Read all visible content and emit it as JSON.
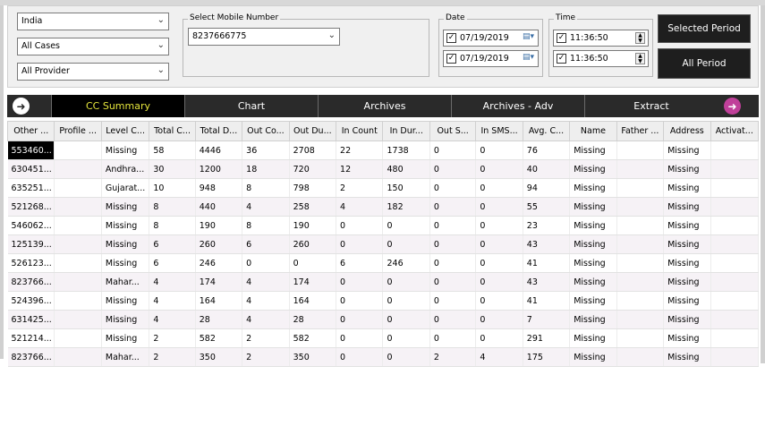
{
  "filters": {
    "country": "India",
    "cases": "All Cases",
    "provider": "All Provider",
    "mobile_legend": "Select Mobile Number",
    "mobile_value": "8237666775",
    "date_legend": "Date",
    "date_from": "07/19/2019",
    "date_to": "07/19/2019",
    "time_legend": "Time",
    "time_from": "11:36:50",
    "time_to": "11:36:50",
    "selected_period_label": "Selected Period",
    "all_period_label": "All Period"
  },
  "tabs": [
    "CC Summary",
    "Chart",
    "Archives",
    "Archives - Adv",
    "Extract"
  ],
  "active_tab": "CC Summary",
  "columns": [
    "Other ...",
    "Profile ...",
    "Level C...",
    "Total C...",
    "Total D...",
    "Out Co...",
    "Out Du...",
    "In Count",
    "In Dur...",
    "Out S...",
    "In SMS...",
    "Avg. C...",
    "Name",
    "Father ...",
    "Address",
    "Activat..."
  ],
  "rows": [
    [
      "553460...",
      "",
      "Missing",
      "58",
      "4446",
      "36",
      "2708",
      "22",
      "1738",
      "0",
      "0",
      "76",
      "Missing",
      "",
      "Missing",
      ""
    ],
    [
      "630451...",
      "",
      "Andhra...",
      "30",
      "1200",
      "18",
      "720",
      "12",
      "480",
      "0",
      "0",
      "40",
      "Missing",
      "",
      "Missing",
      ""
    ],
    [
      "635251...",
      "",
      "Gujarat...",
      "10",
      "948",
      "8",
      "798",
      "2",
      "150",
      "0",
      "0",
      "94",
      "Missing",
      "",
      "Missing",
      ""
    ],
    [
      "521268...",
      "",
      "Missing",
      "8",
      "440",
      "4",
      "258",
      "4",
      "182",
      "0",
      "0",
      "55",
      "Missing",
      "",
      "Missing",
      ""
    ],
    [
      "546062...",
      "",
      "Missing",
      "8",
      "190",
      "8",
      "190",
      "0",
      "0",
      "0",
      "0",
      "23",
      "Missing",
      "",
      "Missing",
      ""
    ],
    [
      "125139...",
      "",
      "Missing",
      "6",
      "260",
      "6",
      "260",
      "0",
      "0",
      "0",
      "0",
      "43",
      "Missing",
      "",
      "Missing",
      ""
    ],
    [
      "526123...",
      "",
      "Missing",
      "6",
      "246",
      "0",
      "0",
      "6",
      "246",
      "0",
      "0",
      "41",
      "Missing",
      "",
      "Missing",
      ""
    ],
    [
      "823766...",
      "",
      "Mahar...",
      "4",
      "174",
      "4",
      "174",
      "0",
      "0",
      "0",
      "0",
      "43",
      "Missing",
      "",
      "Missing",
      ""
    ],
    [
      "524396...",
      "",
      "Missing",
      "4",
      "164",
      "4",
      "164",
      "0",
      "0",
      "0",
      "0",
      "41",
      "Missing",
      "",
      "Missing",
      ""
    ],
    [
      "631425...",
      "",
      "Missing",
      "4",
      "28",
      "4",
      "28",
      "0",
      "0",
      "0",
      "0",
      "7",
      "Missing",
      "",
      "Missing",
      ""
    ],
    [
      "521214...",
      "",
      "Missing",
      "2",
      "582",
      "2",
      "582",
      "0",
      "0",
      "0",
      "0",
      "291",
      "Missing",
      "",
      "Missing",
      ""
    ],
    [
      "823766...",
      "",
      "Mahar...",
      "2",
      "350",
      "2",
      "350",
      "0",
      "0",
      "2",
      "4",
      "175",
      "Missing",
      "",
      "Missing",
      ""
    ]
  ],
  "icons": {
    "back": "arrow-left-circle-icon",
    "forward": "arrow-right-circle-icon",
    "calendar": "calendar-icon",
    "spinner": "spinner-updown-icon",
    "dropdown": "chevron-down-icon"
  },
  "colors": {
    "tab_active_text": "#e6e63c",
    "tab_bar": "#2a2a2a",
    "forward_icon": "#c0409a",
    "selected_cell": "#000000"
  }
}
